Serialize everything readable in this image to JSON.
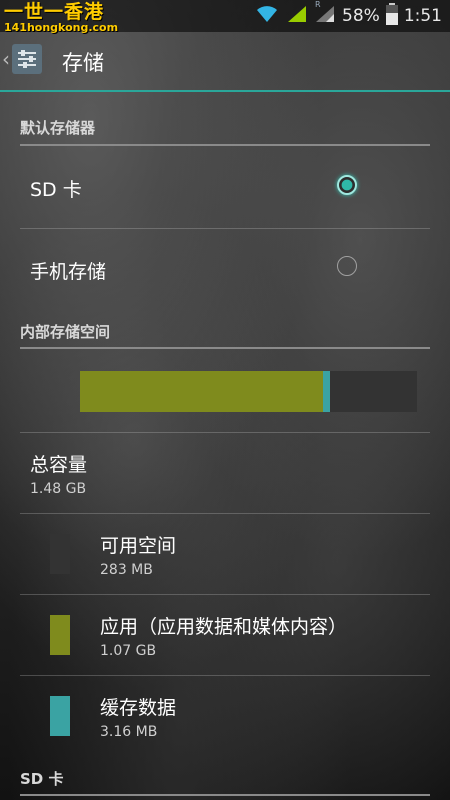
{
  "watermark": {
    "title": "一世一香港",
    "url": "141hongkong.com"
  },
  "status": {
    "battery": "58%",
    "time": "1:51",
    "signal_roaming": "R"
  },
  "action_bar": {
    "title": "存储",
    "back": "‹"
  },
  "default_storage": {
    "header": "默认存储器",
    "options": [
      {
        "label": "SD 卡",
        "selected": true
      },
      {
        "label": "手机存储",
        "selected": false
      }
    ]
  },
  "internal": {
    "header": "内部存储空间",
    "usage": {
      "apps_fraction": 0.722,
      "cache_fraction": 0.021
    },
    "total": {
      "label": "总容量",
      "value": "1.48 GB"
    },
    "items": [
      {
        "label": "可用空间",
        "value": "283 MB",
        "color": "#333333"
      },
      {
        "label": "应用（应用数据和媒体内容）",
        "value": "1.07 GB",
        "color": "#7f8b1d"
      },
      {
        "label": "缓存数据",
        "value": "3.16 MB",
        "color": "#3aa3a3"
      }
    ]
  },
  "sd_section": {
    "header": "SD 卡"
  },
  "colors": {
    "accent": "#2aa79a",
    "apps": "#7f8b1d",
    "cache": "#3aa3a3",
    "free": "#333333"
  }
}
